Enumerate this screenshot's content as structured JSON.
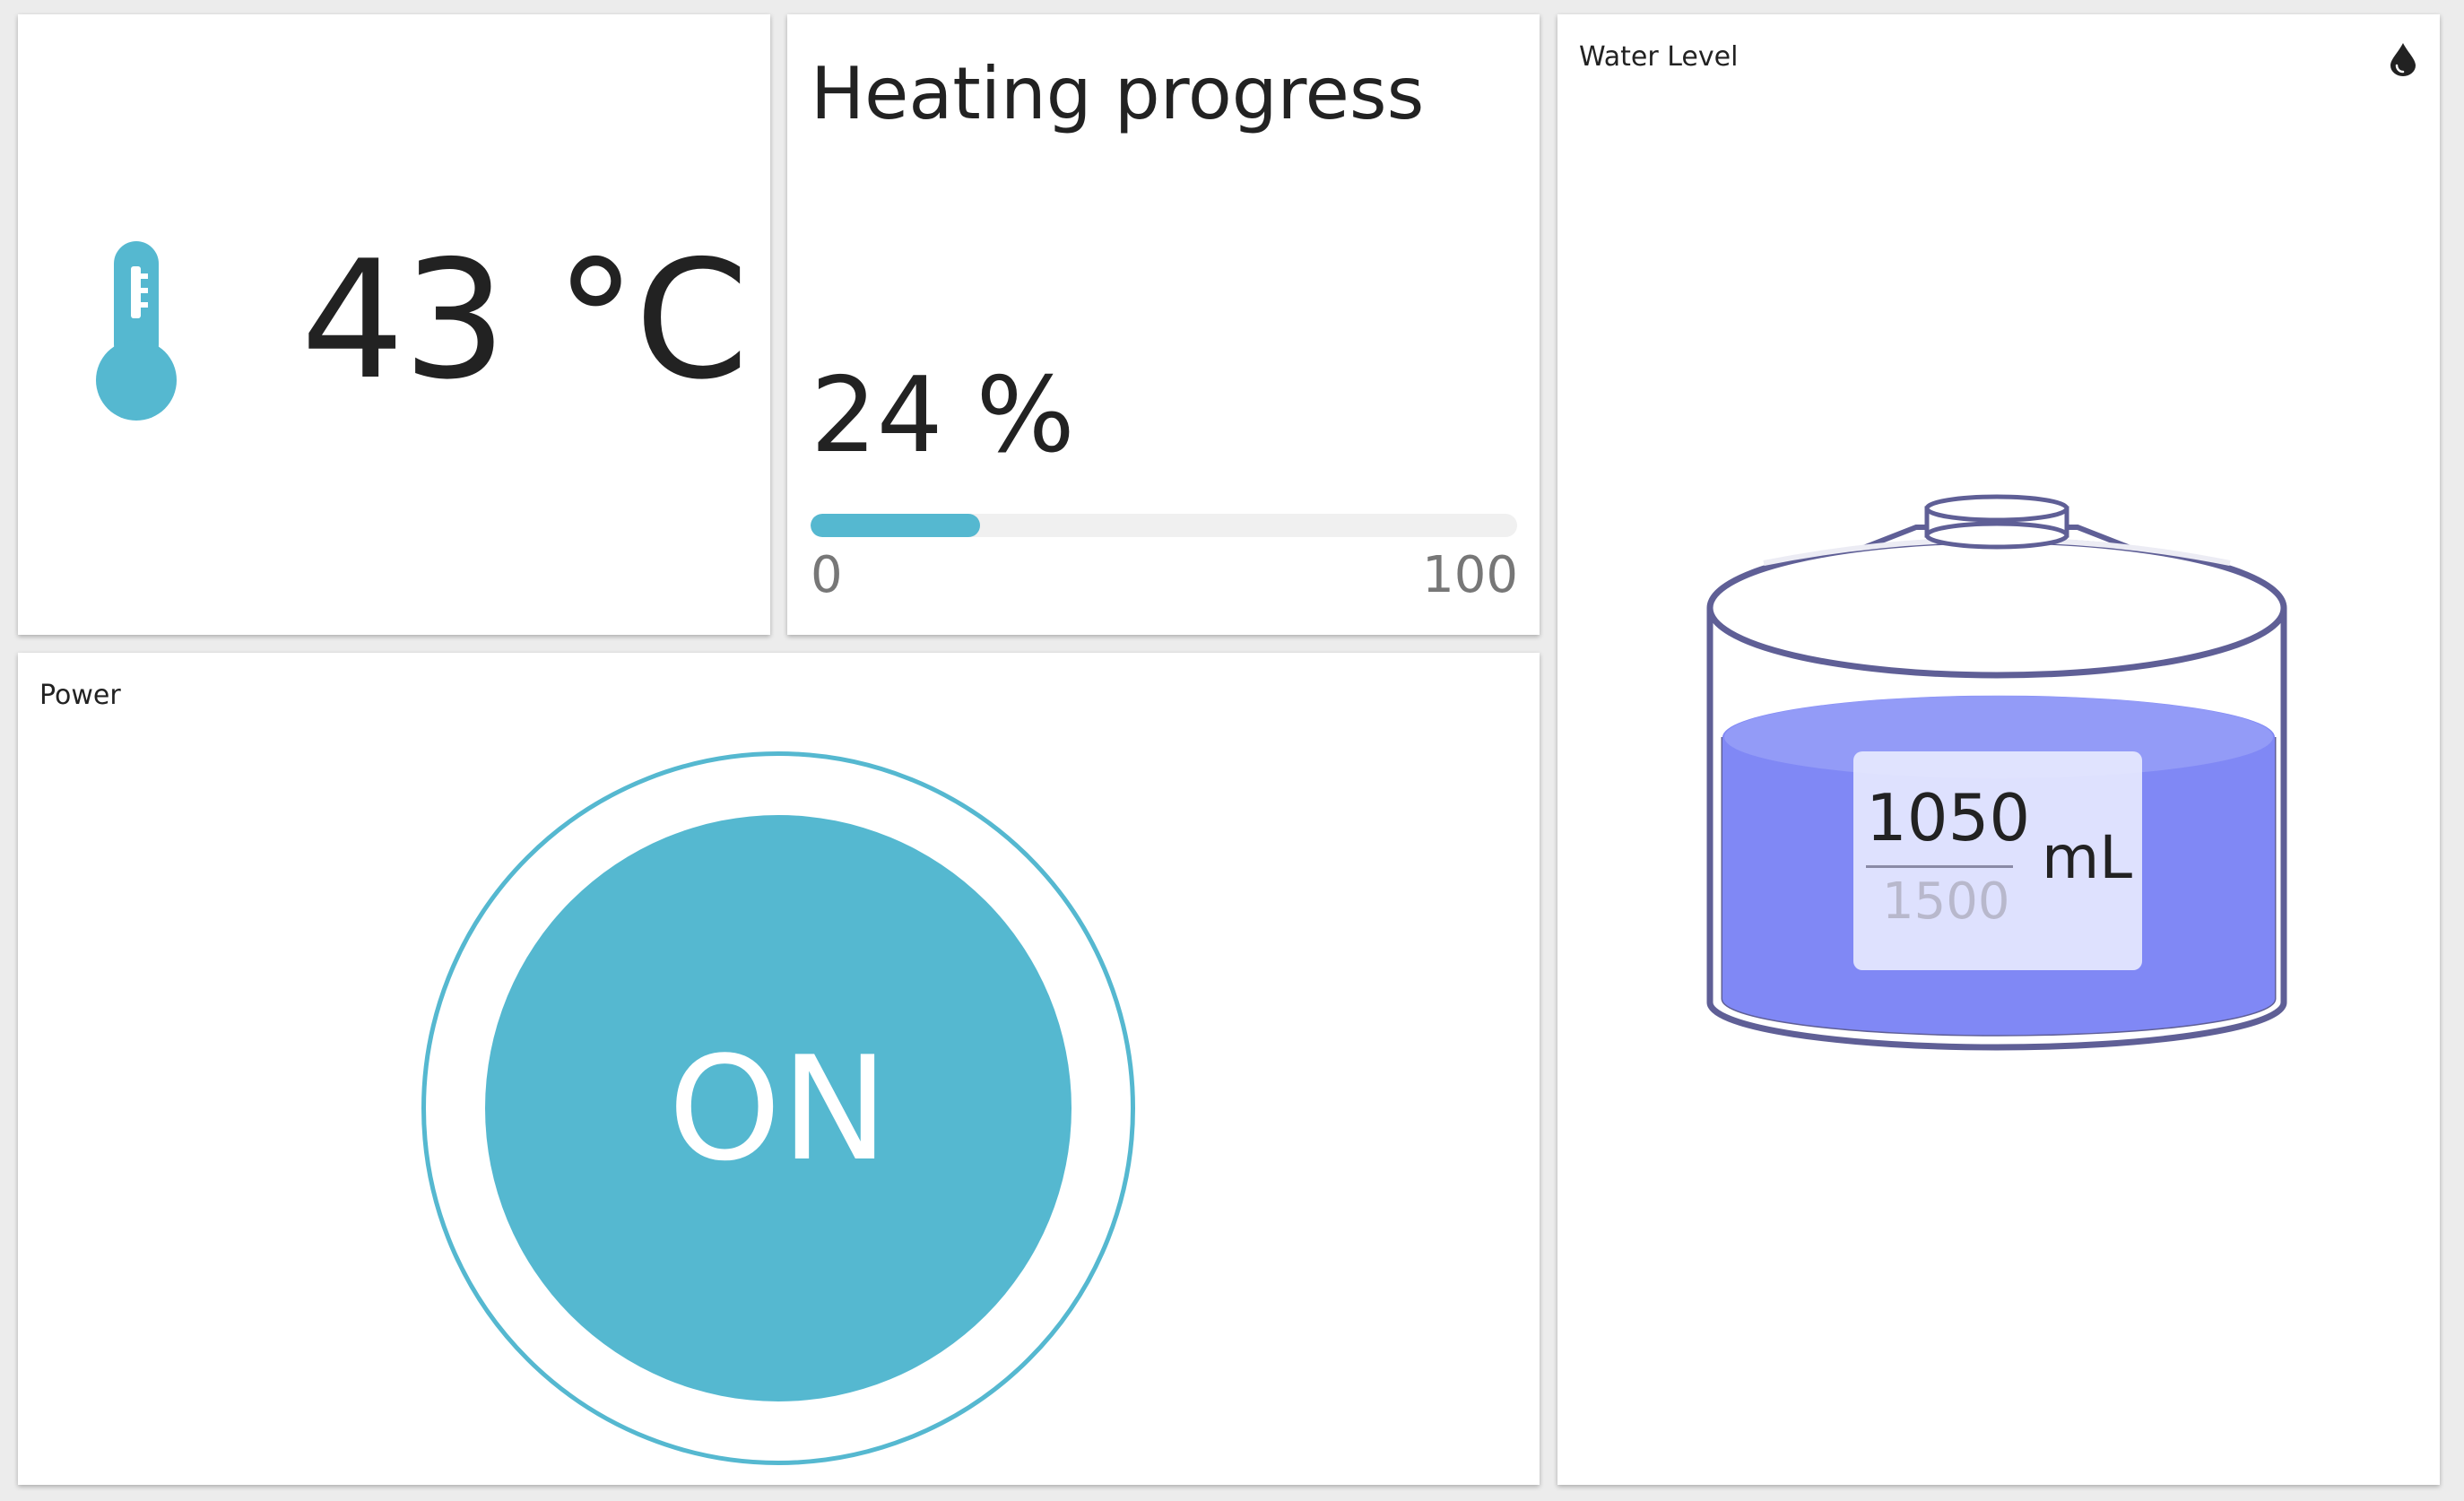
{
  "temperature": {
    "value": "43 °C",
    "icon": "thermometer-icon",
    "color": "#55b8d0"
  },
  "heating": {
    "title": "Heating progress",
    "value_text": "24 %",
    "value": 24,
    "min": "0",
    "max": "100",
    "color": "#55b8d0"
  },
  "power": {
    "title": "Power",
    "state_label": "ON",
    "color": "#55b8d0"
  },
  "water": {
    "title": "Water Level",
    "icon": "water-drop-icon",
    "value": "1050",
    "max": "1500",
    "unit": "mL",
    "fill_fraction": 0.7,
    "liquid_color": "#8088f5",
    "outline_color": "#5f5f96"
  }
}
